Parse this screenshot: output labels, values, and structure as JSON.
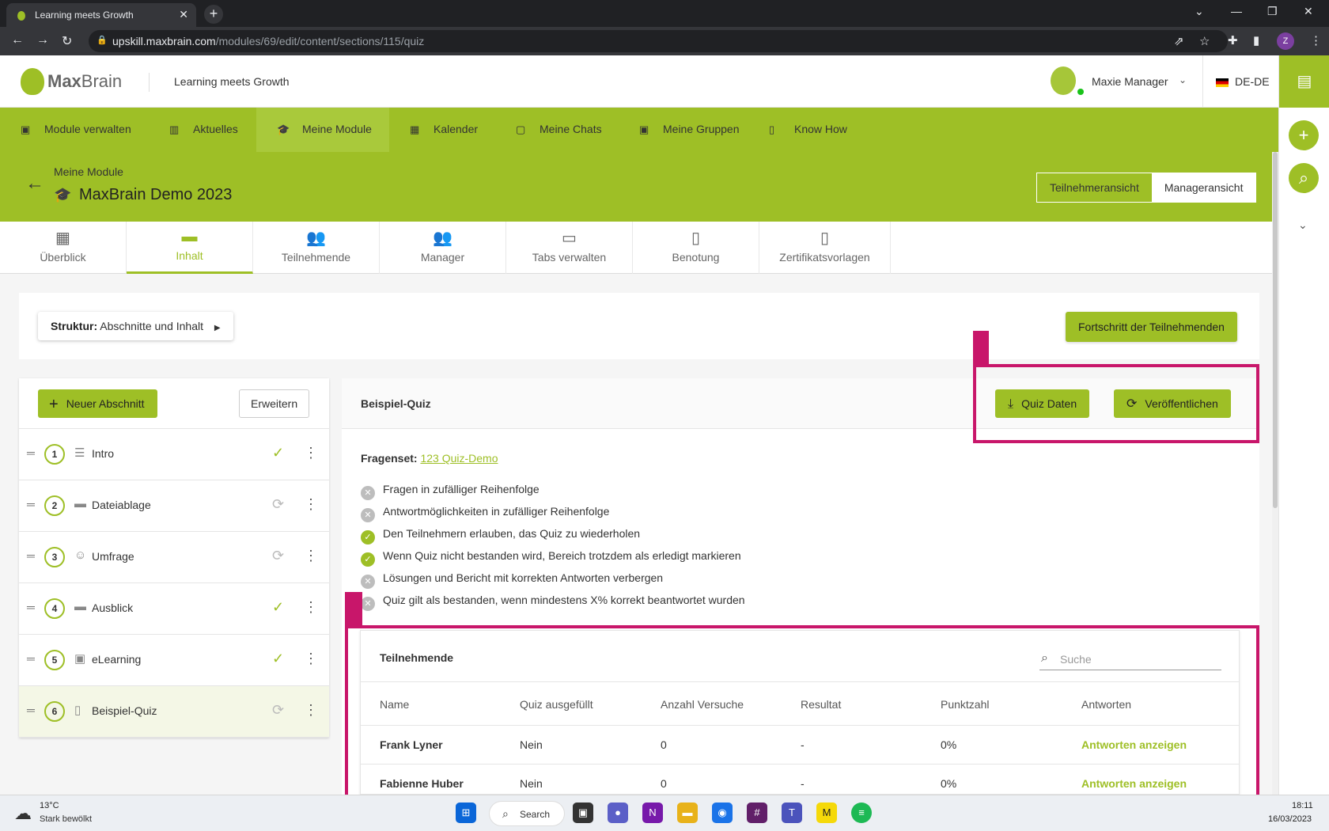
{
  "browser": {
    "tab_title": "Learning meets Growth",
    "url_host": "upskill.maxbrain.com",
    "url_path": "/modules/69/edit/content/sections/115/quiz",
    "profile_initial": "Z"
  },
  "header": {
    "logo_bold": "Max",
    "logo_light": "Brain",
    "tagline": "Learning meets Growth",
    "user_name": "Maxie Manager",
    "language": "DE-DE"
  },
  "mainnav": {
    "items": [
      {
        "label": "Module verwalten",
        "icon": "folder-user-icon"
      },
      {
        "label": "Aktuelles",
        "icon": "news-icon"
      },
      {
        "label": "Meine Module",
        "icon": "graduation-cap-icon"
      },
      {
        "label": "Kalender",
        "icon": "calendar-icon"
      },
      {
        "label": "Meine Chats",
        "icon": "chat-icon"
      },
      {
        "label": "Meine Gruppen",
        "icon": "group-icon"
      },
      {
        "label": "Know How",
        "icon": "book-icon"
      }
    ],
    "active": "Meine Module"
  },
  "page": {
    "breadcrumb": "Meine Module",
    "title": "MaxBrain Demo 2023",
    "view_participant": "Teilnehmeransicht",
    "view_manager": "Manageransicht"
  },
  "subtabs": [
    {
      "label": "Überblick",
      "icon": "dashboard-icon"
    },
    {
      "label": "Inhalt",
      "icon": "folder-icon"
    },
    {
      "label": "Teilnehmende",
      "icon": "people-icon"
    },
    {
      "label": "Manager",
      "icon": "manager-icon"
    },
    {
      "label": "Tabs verwalten",
      "icon": "window-icon"
    },
    {
      "label": "Benotung",
      "icon": "grade-document-icon"
    },
    {
      "label": "Zertifikatsvorlagen",
      "icon": "certificate-icon"
    }
  ],
  "structure": {
    "label_bold": "Struktur:",
    "label_value": "Abschnitte und Inhalt",
    "progress_button": "Fortschritt der Teilnehmenden"
  },
  "sections": {
    "new_button": "Neuer Abschnitt",
    "expand_button": "Erweitern",
    "items": [
      {
        "num": "1",
        "label": "Intro",
        "icon": "text-lines-icon",
        "status": "done"
      },
      {
        "num": "2",
        "label": "Dateiablage",
        "icon": "folder-icon",
        "status": "sync"
      },
      {
        "num": "3",
        "label": "Umfrage",
        "icon": "survey-icon",
        "status": "sync"
      },
      {
        "num": "4",
        "label": "Ausblick",
        "icon": "folder-icon",
        "status": "done"
      },
      {
        "num": "5",
        "label": "eLearning",
        "icon": "elearning-icon",
        "status": "done"
      },
      {
        "num": "6",
        "label": "Beispiel-Quiz",
        "icon": "quiz-icon",
        "status": "sync"
      }
    ]
  },
  "quiz": {
    "title": "Beispiel-Quiz",
    "data_button": "Quiz Daten",
    "publish_button": "Veröffentlichen",
    "fragenset_label": "Fragenset:",
    "fragenset_link": "123 Quiz-Demo",
    "options": [
      {
        "text": "Fragen in zufälliger Reihenfolge",
        "enabled": false
      },
      {
        "text": "Antwortmöglichkeiten in zufälliger Reihenfolge",
        "enabled": false
      },
      {
        "text": "Den Teilnehmern erlauben, das Quiz zu wiederholen",
        "enabled": true
      },
      {
        "text": "Wenn Quiz nicht bestanden wird, Bereich trotzdem als erledigt markieren",
        "enabled": true
      },
      {
        "text": "Lösungen und Bericht mit korrekten Antworten verbergen",
        "enabled": false
      },
      {
        "text": "Quiz gilt als bestanden, wenn mindestens X% korrekt beantwortet wurden",
        "enabled": false
      }
    ]
  },
  "participants": {
    "title": "Teilnehmende",
    "search_placeholder": "Suche",
    "columns": [
      "Name",
      "Quiz ausgefüllt",
      "Anzahl Versuche",
      "Resultat",
      "Punktzahl",
      "Antworten"
    ],
    "rows": [
      {
        "name": "Frank Lyner",
        "filled": "Nein",
        "attempts": "0",
        "result": "-",
        "score": "0%",
        "answers": "Antworten anzeigen"
      },
      {
        "name": "Fabienne Huber",
        "filled": "Nein",
        "attempts": "0",
        "result": "-",
        "score": "0%",
        "answers": "Antworten anzeigen"
      }
    ]
  },
  "taskbar": {
    "temperature": "13°C",
    "weather": "Stark bewölkt",
    "search": "Search",
    "time": "18:11",
    "date": "16/03/2023"
  },
  "colors": {
    "brand_green": "#9ebf26",
    "annotation_magenta": "#c8166a"
  }
}
